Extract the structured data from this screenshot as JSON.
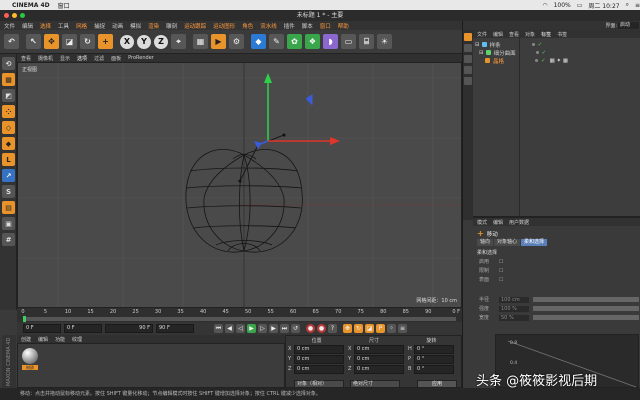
{
  "mac": {
    "app": "CINEMA 4D",
    "window_menu": "窗口",
    "battery": "100%",
    "clock": "周二 10:27"
  },
  "window": {
    "title": "未标题 1 * - 主要"
  },
  "menu": {
    "items": [
      "文件",
      "编辑",
      "选择",
      "工具",
      "网格",
      "捕捉",
      "动画",
      "模拟",
      "渲染",
      "雕刻",
      "运动跟踪",
      "运动图形",
      "角色",
      "流水线",
      "插件",
      "脚本",
      "窗口",
      "帮助"
    ]
  },
  "toolbar": {
    "x_label": "X",
    "y_label": "Y",
    "z_label": "Z"
  },
  "viewport": {
    "menu": [
      "查看",
      "摄像机",
      "显示",
      "选项",
      "过滤",
      "面板",
      "ProRender"
    ],
    "view_name": "正视图",
    "grid_readout": "网格间距：10 cm"
  },
  "timeline": {
    "ticks": [
      "0",
      "5",
      "10",
      "15",
      "20",
      "25",
      "30",
      "35",
      "40",
      "45",
      "50",
      "55",
      "60",
      "65",
      "70",
      "75",
      "80",
      "85",
      "90"
    ],
    "end_label": "0 F"
  },
  "transport": {
    "current_frame": "0 F",
    "start_frame": "0 F",
    "end_frame": "90 F",
    "max_frame": "90 F"
  },
  "material_manager": {
    "menu": [
      "创建",
      "编辑",
      "功能",
      "纹理"
    ],
    "material_name": "材质"
  },
  "coordinates": {
    "headers": [
      "位置",
      "尺寸",
      "旋转"
    ],
    "rows": [
      {
        "axis": "X",
        "pos": "0 cm",
        "size_axis": "X",
        "size": "0 cm",
        "rot_axis": "H",
        "rot": "0 °"
      },
      {
        "axis": "Y",
        "pos": "0 cm",
        "size_axis": "Y",
        "size": "0 cm",
        "rot_axis": "P",
        "rot": "0 °"
      },
      {
        "axis": "Z",
        "pos": "0 cm",
        "size_axis": "Z",
        "size": "0 cm",
        "rot_axis": "B",
        "rot": "0 °"
      }
    ],
    "mode_select": "对象（相对）",
    "size_select": "绝对尺寸",
    "apply_label": "应用"
  },
  "right": {
    "layout_label": "界面:",
    "layout_value": "启动",
    "om_menu": [
      "文件",
      "编辑",
      "查看",
      "对象",
      "标签",
      "书签"
    ],
    "objects": [
      {
        "name": "样条",
        "color": "#5dc0f0"
      },
      {
        "name": "细分曲面",
        "color": "#5dd36a"
      },
      {
        "name": "晶格",
        "color": "#e8942a"
      }
    ],
    "attr_menu": [
      "模式",
      "编辑",
      "用户数据"
    ],
    "tool_name": "移动",
    "attr_tabs": [
      "轴向",
      "对象轴心",
      "柔和选择"
    ],
    "section": "柔和选择",
    "attr_rows": [
      {
        "k": "启用",
        "v": ""
      },
      {
        "k": "限制",
        "v": ""
      },
      {
        "k": "表面",
        "v": ""
      },
      {
        "k": "半径",
        "v": "100 cm"
      },
      {
        "k": "强度",
        "v": "100 %"
      },
      {
        "k": "宽度",
        "v": "50 %"
      }
    ],
    "graph_labels": [
      "0.8",
      "0.4"
    ]
  },
  "status": {
    "text": "移动：点击并拖动鼠标移动元素。按住 SHIFT 键量化移动；节点编辑模式时按住 SHIFT 键增加选择对象；按住 CTRL 键减少选择对象。"
  },
  "brand": {
    "vertical": "MAXON CINEMA 4D"
  },
  "watermark": {
    "text": "头条 @筱筱影视后期"
  },
  "colors": {
    "accent": "#e8942a",
    "axis_x": "#e0352b",
    "axis_y": "#2fd04a",
    "axis_z": "#3a5bdc"
  }
}
